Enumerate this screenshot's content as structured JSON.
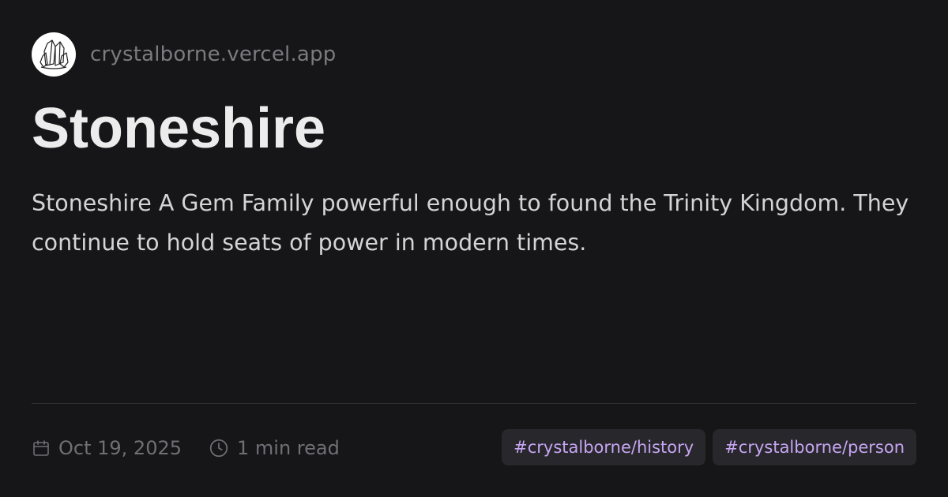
{
  "site": {
    "logo_icon": "crystal-cluster-icon",
    "name": "crystalborne.vercel.app"
  },
  "article": {
    "title": "Stoneshire",
    "description": "Stoneshire A Gem Family powerful enough to found the Trinity Kingdom. They continue to hold seats of power in modern times."
  },
  "meta": {
    "date_icon": "calendar-icon",
    "date": "Oct 19, 2025",
    "read_icon": "clock-icon",
    "read_time": "1 min read"
  },
  "tags": [
    "#crystalborne/history",
    "#crystalborne/person"
  ],
  "colors": {
    "background": "#161618",
    "tag_text": "#c7a6f2",
    "tag_bg": "#27272c"
  }
}
